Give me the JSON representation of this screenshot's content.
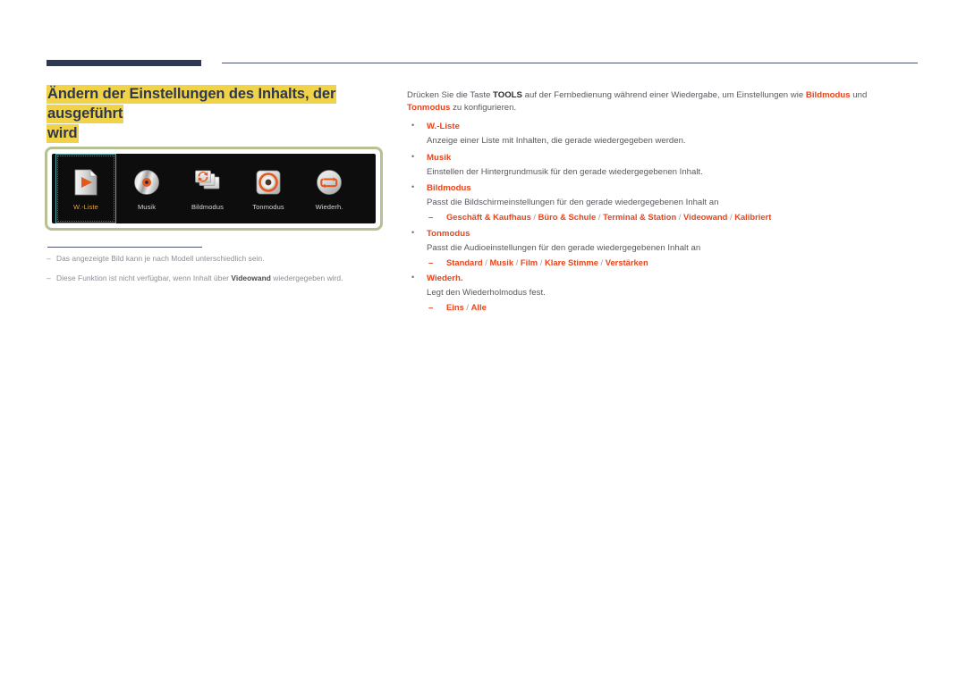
{
  "header": {
    "rule_color": "#2e3855"
  },
  "title": {
    "line1": "Ändern der Einstellungen des Inhalts, der ausgeführt",
    "line2": "wird",
    "highlight_color": "#f0d348",
    "text_color": "#2d3652"
  },
  "figure": {
    "border_color": "#b7c093",
    "background": "#0d0d0d",
    "selected_border_color": "#4fa9ad",
    "selected_label_color": "#e0a33c",
    "accent_color": "#e2581f",
    "items": [
      {
        "label": "W.-Liste",
        "icon": "playlist-document-icon",
        "selected": true
      },
      {
        "label": "Musik",
        "icon": "music-disc-icon",
        "selected": false
      },
      {
        "label": "Bildmodus",
        "icon": "picture-mode-cards-icon",
        "selected": false
      },
      {
        "label": "Tonmodus",
        "icon": "sound-mode-speaker-icon",
        "selected": false
      },
      {
        "label": "Wiederh.",
        "icon": "repeat-loop-icon",
        "selected": false
      }
    ]
  },
  "footnotes": [
    {
      "dash": "–",
      "pre": "Das angezeigte Bild kann je nach Modell unterschiedlich sein.",
      "bold": "",
      "post": ""
    },
    {
      "dash": "–",
      "pre": "Diese Funktion ist nicht verfügbar, wenn Inhalt über ",
      "bold": "Videowand",
      "post": " wiedergegeben wird."
    }
  ],
  "content": {
    "intro": {
      "p1": "Drücken Sie die Taste ",
      "tools": "TOOLS",
      "p2": " auf der Fernbedienung während einer Wiedergabe, um Einstellungen wie ",
      "kw1": "Bildmodus",
      "p3": " und",
      "kw2": "Tonmodus",
      "p4": " zu konfigurieren."
    },
    "items": [
      {
        "title": "W.-Liste",
        "desc": "Anzeige einer Liste mit Inhalten, die gerade wiedergegeben werden.",
        "options": ""
      },
      {
        "title": "Musik",
        "desc": "Einstellen der Hintergrundmusik für den gerade wiedergegebenen Inhalt.",
        "options": ""
      },
      {
        "title": "Bildmodus",
        "desc": "Passt die Bildschirmeinstellungen für den gerade wiedergegebenen Inhalt an",
        "options": "Geschäft & Kaufhaus / Büro & Schule / Terminal & Station / Videowand / Kalibriert",
        "option_list": [
          "Geschäft & Kaufhaus",
          "Büro & Schule",
          "Terminal & Station",
          "Videowand",
          "Kalibriert"
        ]
      },
      {
        "title": "Tonmodus",
        "desc": "Passt die Audioeinstellungen für den gerade wiedergegebenen Inhalt an",
        "options": "Standard / Musik / Film / Klare Stimme / Verstärken",
        "option_list": [
          "Standard",
          "Musik",
          "Film",
          "Klare Stimme",
          "Verstärken"
        ]
      },
      {
        "title": "Wiederh.",
        "desc": "Legt den Wiederholmodus fest.",
        "options": "Eins / Alle",
        "option_list": [
          "Eins",
          "Alle"
        ]
      }
    ]
  },
  "colors": {
    "accent_red": "#e8441b",
    "body_text": "#58585e",
    "navy": "#2d3652",
    "highlight_yellow": "#f0d348",
    "frame_green": "#b7c093"
  }
}
